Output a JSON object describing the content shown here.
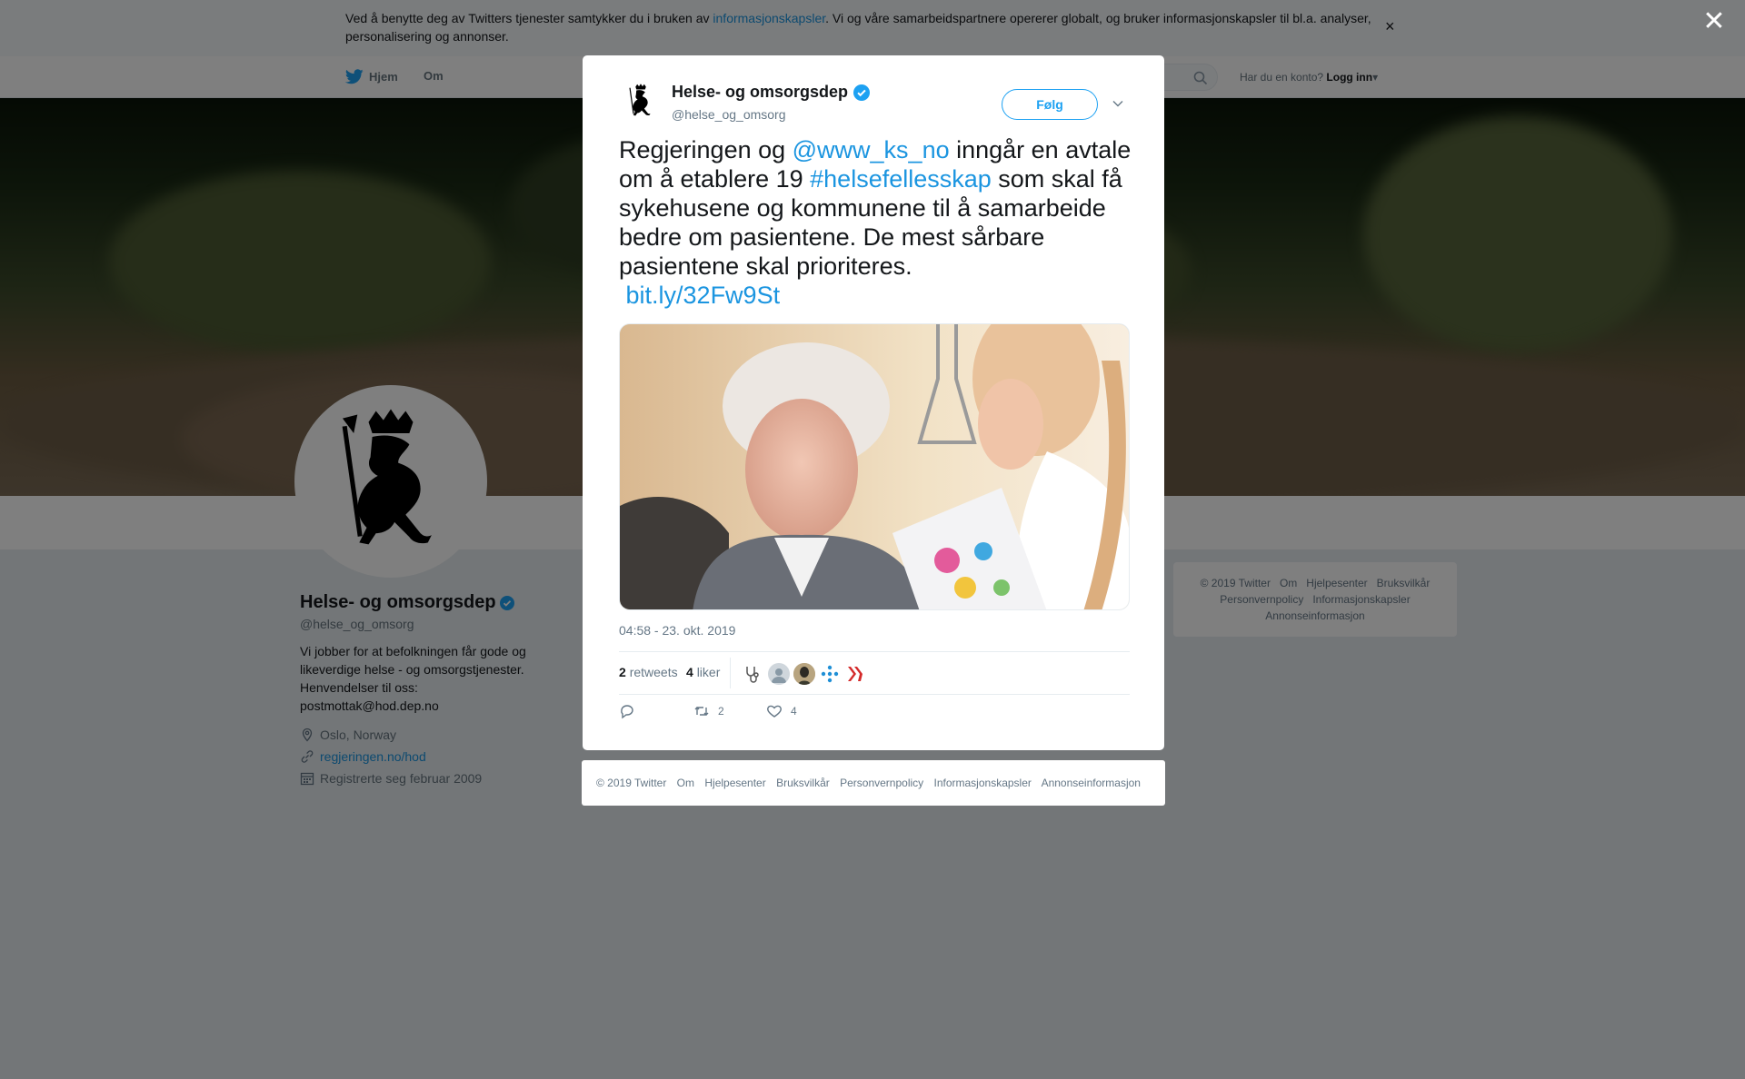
{
  "cookie_banner": {
    "text_before": "Ved å benytte deg av Twitters tjenester samtykker du i bruken av ",
    "link": "informasjonskapsler",
    "text_after": ". Vi og våre samarbeidspartnere opererer globalt, og bruker informasjonskapsler til bl.a. analyser, personalisering og annonser.",
    "close": "×"
  },
  "nav": {
    "home": "Hjem",
    "about": "Om",
    "account_prompt": "Har du en konto?",
    "login": "Logg inn"
  },
  "profile": {
    "name": "Helse- og omsorgsdep",
    "handle": "@helse_og_omsorg",
    "bio": "Vi jobber for at befolkningen får gode og likeverdige helse - og omsorgstjenester. Henvendelser til oss: postmottak@hod.dep.no",
    "location": "Oslo, Norway",
    "website": "regjeringen.no/hod",
    "joined": "Registrerte seg februar 2009"
  },
  "side_footer": {
    "items": [
      "© 2019 Twitter",
      "Om",
      "Hjelpesenter",
      "Bruksvilkår",
      "Personvernpolicy",
      "Informasjonskapsler",
      "Annonseinformasjon"
    ]
  },
  "overlay": {
    "close": "✕"
  },
  "tweet": {
    "name": "Helse- og omsorgsdep",
    "handle": "@helse_og_omsorg",
    "follow": "Følg",
    "text": {
      "p1": "Regjeringen og ",
      "mention": "@www_ks_no",
      "p2": " inngår en avtale om å etablere 19 ",
      "hashtag": "#helsefellesskap",
      "p3": " som skal få sykehusene og kommunene til å samarbeide bedre om pasientene. De mest sårbare pasientene skal prioriteres.",
      "url": "bit.ly/32Fw9St"
    },
    "timestamp": "04:58 - 23. okt. 2019",
    "retweets_count": "2",
    "retweets_label": "retweets",
    "likes_count": "4",
    "likes_label": "liker",
    "reply_count": "",
    "retweet_action_count": "2",
    "like_action_count": "4"
  },
  "modal_footer": {
    "items": [
      "© 2019 Twitter",
      "Om",
      "Hjelpesenter",
      "Bruksvilkår",
      "Personvernpolicy",
      "Informasjonskapsler",
      "Annonseinformasjon"
    ]
  },
  "colors": {
    "twitter_blue": "#1da1f2",
    "link_blue": "#1b95e0",
    "text_dark": "#14171a",
    "text_grey": "#657786"
  }
}
